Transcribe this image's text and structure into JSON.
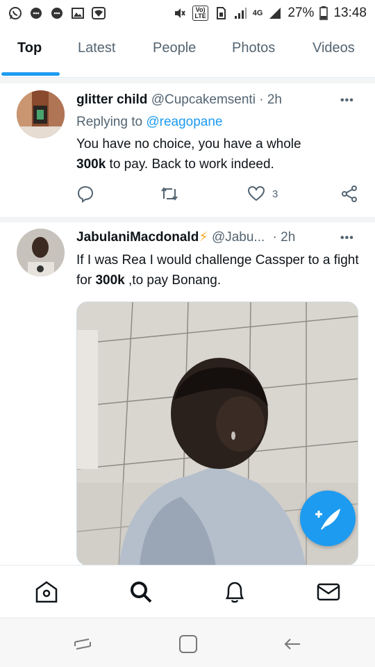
{
  "status_bar": {
    "battery": "27%",
    "time": "13:48",
    "network": "4G",
    "volte_line1": "Vo)",
    "volte_line2": "LTE"
  },
  "tabs": [
    {
      "label": "Top",
      "active": true
    },
    {
      "label": "Latest"
    },
    {
      "label": "People"
    },
    {
      "label": "Photos"
    },
    {
      "label": "Videos"
    }
  ],
  "tweets": [
    {
      "name": "glitter child",
      "handle": "@Cupcakemsenti",
      "time": "· 2h",
      "replying_label": "Replying to",
      "replying_to": "@reagopane",
      "text_1": "You have no choice, you have a whole",
      "text_bold": "300k",
      "text_2": " to pay. Back to work indeed.",
      "like_count": "3"
    },
    {
      "name": "JabulaniMacdonald",
      "emoji": "⚡",
      "handle": "@Jabu...",
      "time": "· 2h",
      "text_1": "If I was Rea I would challenge Cassper to a fight for ",
      "text_bold": "300k",
      "text_2": " ,to pay Bonang."
    }
  ],
  "colors": {
    "accent": "#1d9bf0",
    "text": "#0f1419",
    "secondary": "#536471"
  },
  "icons": {
    "status_left": [
      "whatsapp-icon",
      "chat-icon",
      "chat-icon",
      "gallery-icon",
      "wifi-icon"
    ],
    "status_right": [
      "mute-icon",
      "volte-icon",
      "sim-icon",
      "signal-icon",
      "signal-icon",
      "battery-icon"
    ],
    "tweet_actions": [
      "reply-icon",
      "retweet-icon",
      "like-icon",
      "share-icon"
    ],
    "bottom_nav": [
      "home-icon",
      "search-icon",
      "notifications-icon",
      "messages-icon"
    ],
    "system_nav": [
      "recents-icon",
      "home-button-icon",
      "back-icon"
    ],
    "fab": "compose-tweet-icon"
  }
}
